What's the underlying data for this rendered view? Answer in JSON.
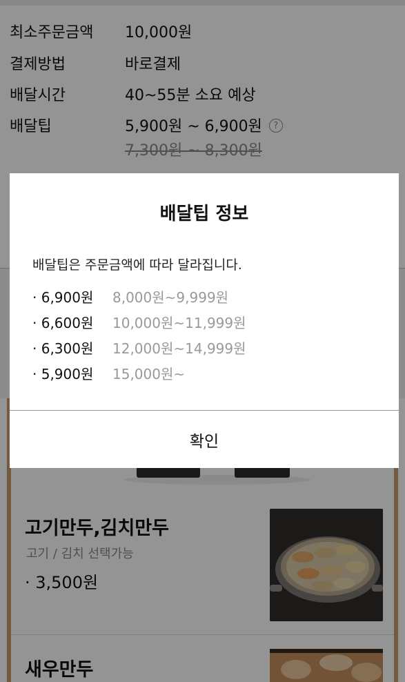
{
  "store_info": {
    "rows": [
      {
        "key": "최소주문금액",
        "value": "10,000원"
      },
      {
        "key": "결제방법",
        "value": "바로결제"
      },
      {
        "key": "배달시간",
        "value": "40~55분 소요 예상"
      },
      {
        "key": "배달팁",
        "value": "5,900원 ~ 6,900원"
      }
    ],
    "help_icon": "?",
    "original_tip": "7,300원 ~ 8,300원"
  },
  "menu": {
    "items": [
      {
        "title": "고기만두,김치만두",
        "subtitle": "고기 / 김치 선택가능",
        "price": "· 3,500원"
      },
      {
        "title": "새우만두"
      }
    ]
  },
  "modal": {
    "title": "배달팁 정보",
    "description": "배달팁은 주문금액에 따라 달라집니다.",
    "tiers": [
      {
        "fee": "· 6,900원",
        "range": "8,000원~9,999원"
      },
      {
        "fee": "· 6,600원",
        "range": "10,000원~11,999원"
      },
      {
        "fee": "· 6,300원",
        "range": "12,000원~14,999원"
      },
      {
        "fee": "· 5,900원",
        "range": "15,000원~"
      }
    ],
    "confirm_label": "확인"
  },
  "colors": {
    "overlay": "rgba(0,0,0,0.42)",
    "accent_border": "#c99b6d",
    "muted_text": "#999999"
  }
}
